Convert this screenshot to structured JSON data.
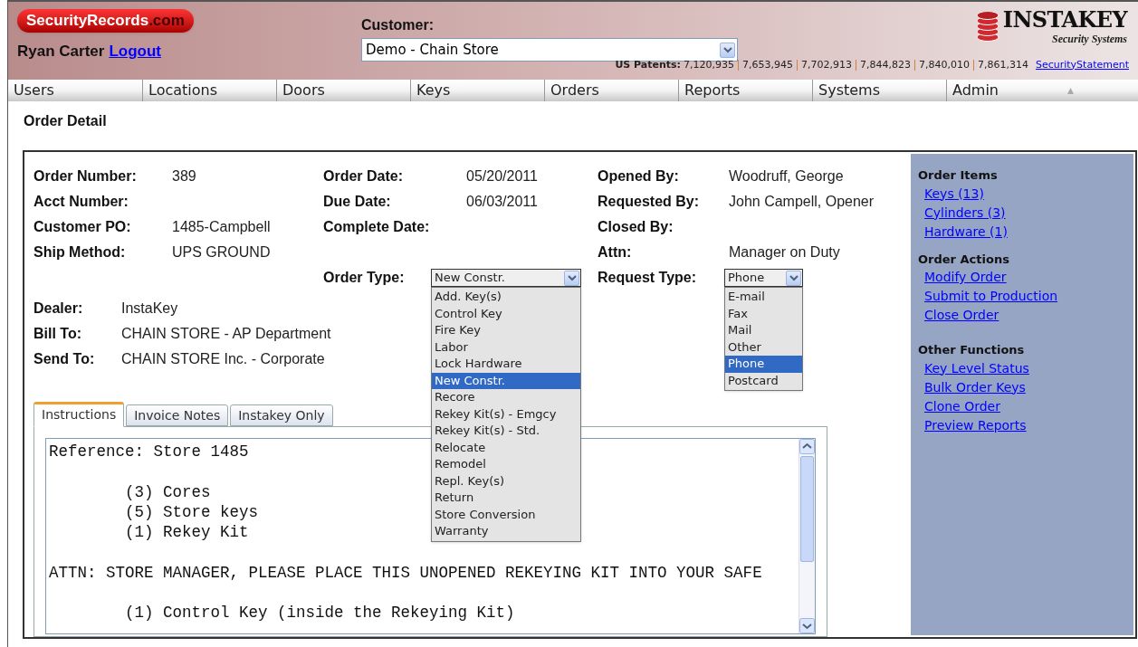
{
  "header": {
    "logo_name": "SecurityRecords",
    "logo_suffix": ".com",
    "user": "Ryan Carter",
    "logout": "Logout",
    "customer_label": "Customer:",
    "customer_value": "Demo - Chain Store",
    "brand": "INSTAKEY",
    "brand_tagline": "Security Systems",
    "patents_label": "US Patents:",
    "patents": [
      "7,120,935",
      "7,653,945",
      "7,702,913",
      "7,844,823",
      "7,840,010",
      "7,861,314"
    ],
    "security_link": "SecurityStatement"
  },
  "nav": [
    {
      "label": "Users"
    },
    {
      "label": "Locations"
    },
    {
      "label": "Doors"
    },
    {
      "label": "Keys"
    },
    {
      "label": "Orders"
    },
    {
      "label": "Reports"
    },
    {
      "label": "Systems"
    },
    {
      "label": "Admin"
    }
  ],
  "page_title": "Order Detail",
  "columns": [
    [
      {
        "label": "Order Number:",
        "value": "389"
      },
      {
        "label": "Acct Number:"
      },
      {
        "label": "Customer PO:",
        "value": "1485-Campbell"
      },
      {
        "label": "Ship Method:",
        "value": "UPS GROUND"
      }
    ],
    [
      {
        "label": "Order Date:",
        "value": "05/20/2011"
      },
      {
        "label": "Due Date:",
        "value": "06/03/2011"
      },
      {
        "label": "Complete Date:"
      }
    ],
    [
      {
        "label": "Opened By:",
        "value": "Woodruff, George"
      },
      {
        "label": "Requested By:",
        "value": "John Campell, Opener"
      },
      {
        "label": "Closed By:"
      },
      {
        "label": "Attn:",
        "value": "Manager on Duty"
      }
    ]
  ],
  "order_type": {
    "label": "Order Type:",
    "value": "New Constr.",
    "expanded": true,
    "options": [
      {
        "label": "Add. Key(s)",
        "selected": false
      },
      {
        "label": "Control Key",
        "selected": false
      },
      {
        "label": "Fire Key",
        "selected": false
      },
      {
        "label": "Labor",
        "selected": false
      },
      {
        "label": "Lock Hardware",
        "selected": false
      },
      {
        "label": "New Constr.",
        "selected": true
      },
      {
        "label": "Recore",
        "selected": false
      },
      {
        "label": "Rekey Kit(s) - Emgcy",
        "selected": false
      },
      {
        "label": "Rekey Kit(s) - Std.",
        "selected": false
      },
      {
        "label": "Relocate",
        "selected": false
      },
      {
        "label": "Remodel",
        "selected": false
      },
      {
        "label": "Repl. Key(s)",
        "selected": false
      },
      {
        "label": "Return",
        "selected": false
      },
      {
        "label": "Store Conversion",
        "selected": false
      },
      {
        "label": "Warranty",
        "selected": false
      }
    ]
  },
  "request_type": {
    "label": "Request Type:",
    "value": "Phone",
    "expanded": true,
    "options": [
      {
        "label": "E-mail",
        "selected": false
      },
      {
        "label": "Fax",
        "selected": false
      },
      {
        "label": "Mail",
        "selected": false
      },
      {
        "label": "Other",
        "selected": false
      },
      {
        "label": "Phone",
        "selected": true
      },
      {
        "label": "Postcard",
        "selected": false
      }
    ]
  },
  "parties": [
    {
      "label": "Dealer:",
      "value": "InstaKey"
    },
    {
      "label": "Bill To:",
      "value": "CHAIN STORE - AP Department"
    },
    {
      "label": "Send To:",
      "value": "CHAIN STORE Inc. - Corporate"
    }
  ],
  "tabs": [
    {
      "label": "Instructions",
      "selected": true
    },
    {
      "label": "Invoice Notes",
      "selected": false
    },
    {
      "label": "Instakey Only",
      "selected": false
    }
  ],
  "instructions": [
    [
      "Reference: Store 1485"
    ],
    [
      "        (3) Cores",
      "        (5) Store keys",
      "        (1) Rekey Kit"
    ],
    [
      "ATTN: STORE MANAGER, PLEASE PLACE THIS UNOPENED REKEYING KIT INTO YOUR SAFE"
    ],
    [
      "        (1) Control Key (inside the Rekeying Kit)"
    ]
  ],
  "sidebar": [
    {
      "title": "Order Items",
      "links": [
        "Keys (13)",
        "Cylinders (3)",
        "Hardware (1)"
      ]
    },
    {
      "title": "Order Actions",
      "links": [
        "Modify Order",
        "Submit to Production",
        "Close Order"
      ]
    },
    {
      "title": "Other Functions",
      "links": [
        "Key Level Status",
        "Bulk Order Keys",
        "Clone Order",
        "Preview Reports"
      ]
    }
  ]
}
